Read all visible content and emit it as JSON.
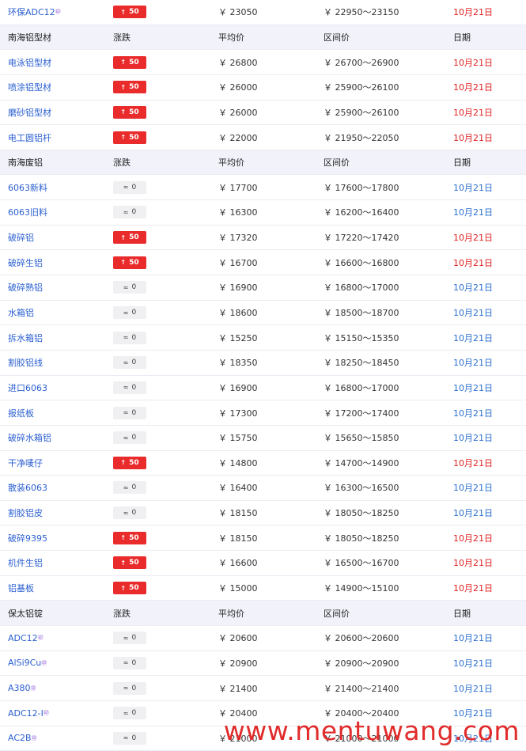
{
  "colors": {
    "up": "#ea2b2b",
    "flat_date": "#2a6fd0",
    "header_bg": "#f1f2fa",
    "name": "#2a5fd0"
  },
  "rows": [
    {
      "type": "item",
      "name": "环保ADC12",
      "sup": "㊞",
      "change": "50",
      "dir": "up",
      "avg": "￥ 23050",
      "range": "￥ 22950～23150",
      "date": "10月21日"
    },
    {
      "type": "header",
      "name": "南海铝型材",
      "change": "涨跌",
      "avg": "平均价",
      "range": "区间价",
      "date": "日期"
    },
    {
      "type": "item",
      "name": "电泳铝型材",
      "change": "50",
      "dir": "up",
      "avg": "￥ 26800",
      "range": "￥ 26700～26900",
      "date": "10月21日"
    },
    {
      "type": "item",
      "name": "喷涂铝型材",
      "change": "50",
      "dir": "up",
      "avg": "￥ 26000",
      "range": "￥ 25900～26100",
      "date": "10月21日"
    },
    {
      "type": "item",
      "name": "磨砂铝型材",
      "change": "50",
      "dir": "up",
      "avg": "￥ 26000",
      "range": "￥ 25900～26100",
      "date": "10月21日"
    },
    {
      "type": "item",
      "name": "电工圆铝杆",
      "change": "50",
      "dir": "up",
      "avg": "￥ 22000",
      "range": "￥ 21950～22050",
      "date": "10月21日"
    },
    {
      "type": "header",
      "name": "南海废铝",
      "change": "涨跌",
      "avg": "平均价",
      "range": "区间价",
      "date": "日期"
    },
    {
      "type": "item",
      "name": "6063新料",
      "change": "0",
      "dir": "flat",
      "avg": "￥ 17700",
      "range": "￥ 17600～17800",
      "date": "10月21日"
    },
    {
      "type": "item",
      "name": "6063旧料",
      "change": "0",
      "dir": "flat",
      "avg": "￥ 16300",
      "range": "￥ 16200～16400",
      "date": "10月21日"
    },
    {
      "type": "item",
      "name": "破碎铝",
      "change": "50",
      "dir": "up",
      "avg": "￥ 17320",
      "range": "￥ 17220～17420",
      "date": "10月21日"
    },
    {
      "type": "item",
      "name": "破碎生铝",
      "change": "50",
      "dir": "up",
      "avg": "￥ 16700",
      "range": "￥ 16600～16800",
      "date": "10月21日"
    },
    {
      "type": "item",
      "name": "破碎熟铝",
      "change": "0",
      "dir": "flat",
      "avg": "￥ 16900",
      "range": "￥ 16800～17000",
      "date": "10月21日"
    },
    {
      "type": "item",
      "name": "水箱铝",
      "change": "0",
      "dir": "flat",
      "avg": "￥ 18600",
      "range": "￥ 18500～18700",
      "date": "10月21日"
    },
    {
      "type": "item",
      "name": "拆水箱铝",
      "change": "0",
      "dir": "flat",
      "avg": "￥ 15250",
      "range": "￥ 15150～15350",
      "date": "10月21日"
    },
    {
      "type": "item",
      "name": "割胶铝线",
      "change": "0",
      "dir": "flat",
      "avg": "￥ 18350",
      "range": "￥ 18250～18450",
      "date": "10月21日"
    },
    {
      "type": "item",
      "name": "进口6063",
      "change": "0",
      "dir": "flat",
      "avg": "￥ 16900",
      "range": "￥ 16800～17000",
      "date": "10月21日"
    },
    {
      "type": "item",
      "name": "报纸板",
      "change": "0",
      "dir": "flat",
      "avg": "￥ 17300",
      "range": "￥ 17200～17400",
      "date": "10月21日"
    },
    {
      "type": "item",
      "name": "破碎水箱铝",
      "change": "0",
      "dir": "flat",
      "avg": "￥ 15750",
      "range": "￥ 15650～15850",
      "date": "10月21日"
    },
    {
      "type": "item",
      "name": "干净唛仔",
      "change": "50",
      "dir": "up",
      "avg": "￥ 14800",
      "range": "￥ 14700～14900",
      "date": "10月21日"
    },
    {
      "type": "item",
      "name": "散装6063",
      "change": "0",
      "dir": "flat",
      "avg": "￥ 16400",
      "range": "￥ 16300～16500",
      "date": "10月21日"
    },
    {
      "type": "item",
      "name": "割胶铝皮",
      "change": "0",
      "dir": "flat",
      "avg": "￥ 18150",
      "range": "￥ 18050～18250",
      "date": "10月21日"
    },
    {
      "type": "item",
      "name": "破碎9395",
      "change": "50",
      "dir": "up",
      "avg": "￥ 18150",
      "range": "￥ 18050～18250",
      "date": "10月21日"
    },
    {
      "type": "item",
      "name": "机件生铝",
      "change": "50",
      "dir": "up",
      "avg": "￥ 16600",
      "range": "￥ 16500～16700",
      "date": "10月21日"
    },
    {
      "type": "item",
      "name": "铝基板",
      "change": "50",
      "dir": "up",
      "avg": "￥ 15000",
      "range": "￥ 14900～15100",
      "date": "10月21日"
    },
    {
      "type": "header",
      "name": "保太铝锭",
      "change": "涨跌",
      "avg": "平均价",
      "range": "区间价",
      "date": "日期"
    },
    {
      "type": "item",
      "name": "ADC12",
      "sup": "㊞",
      "change": "0",
      "dir": "flat",
      "avg": "￥ 20600",
      "range": "￥ 20600～20600",
      "date": "10月21日"
    },
    {
      "type": "item",
      "name": "AlSi9Cu",
      "sup": "㊞",
      "change": "0",
      "dir": "flat",
      "avg": "￥ 20900",
      "range": "￥ 20900～20900",
      "date": "10月21日"
    },
    {
      "type": "item",
      "name": "A380",
      "sup": "㊞",
      "change": "0",
      "dir": "flat",
      "avg": "￥ 21400",
      "range": "￥ 21400～21400",
      "date": "10月21日"
    },
    {
      "type": "item",
      "name": "ADC12-I",
      "sup": "㊞",
      "change": "0",
      "dir": "flat",
      "avg": "￥ 20400",
      "range": "￥ 20400～20400",
      "date": "10月21日"
    },
    {
      "type": "item",
      "name": "AC2B",
      "sup": "㊞",
      "change": "0",
      "dir": "flat",
      "avg": "￥ 21000",
      "range": "￥ 21000～21000",
      "date": "10月21日"
    }
  ],
  "watermark": "www.mentuwang.com"
}
